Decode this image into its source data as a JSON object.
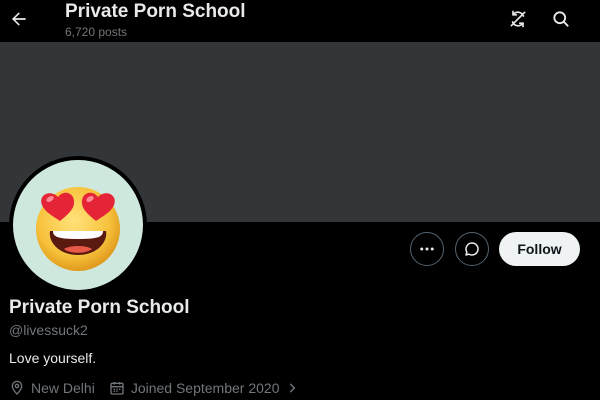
{
  "header": {
    "title": "Private Porn School",
    "posts_count": "6,720 posts",
    "back_icon": "arrow-left-icon",
    "refresh_icon": "refresh-icon",
    "search_icon": "search-icon"
  },
  "banner": {
    "color": "#333639"
  },
  "avatar": {
    "icon": "heart-eyes-emoji",
    "bg": "#cfe8dd"
  },
  "actions": {
    "more_icon": "more-icon",
    "message_icon": "message-icon",
    "follow_label": "Follow"
  },
  "profile": {
    "name": "Private Porn School",
    "handle": "@livessuck2",
    "bio": "Love yourself.",
    "location": "New Delhi",
    "joined": "Joined September 2020"
  },
  "colors": {
    "background": "#000000",
    "text": "#e7e9ea",
    "muted": "#71767b",
    "follow_bg": "#eff3f4"
  }
}
